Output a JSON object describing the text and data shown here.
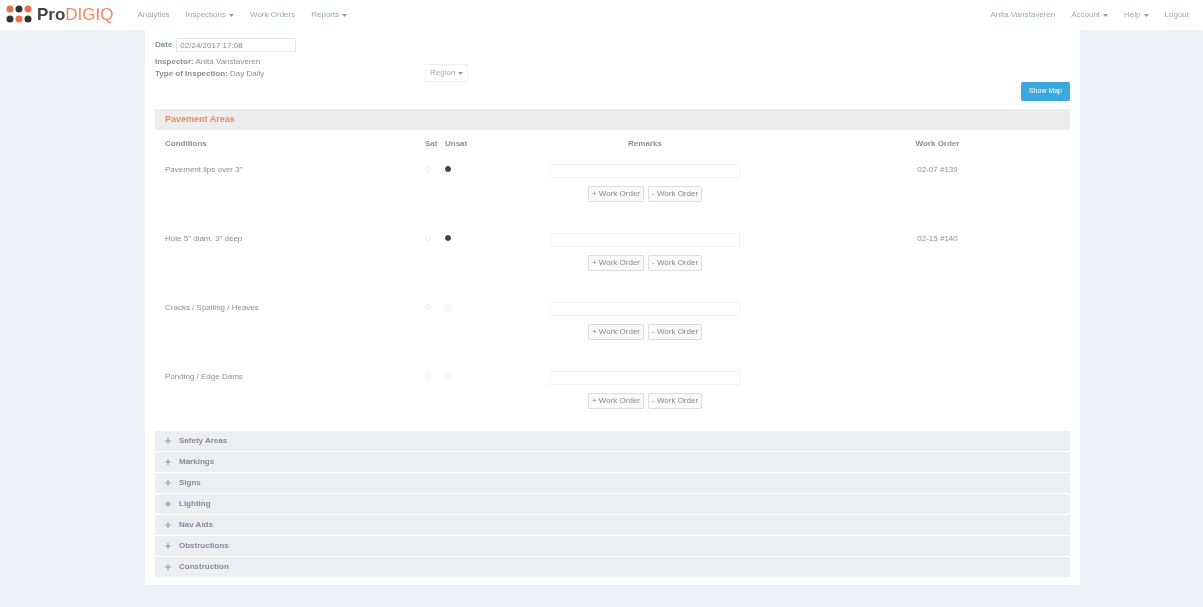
{
  "brand": {
    "prefix": "Pro",
    "suffix": "DIGIQ"
  },
  "nav_left": [
    {
      "label": "Analytics",
      "dropdown": false
    },
    {
      "label": "Inspections",
      "dropdown": true
    },
    {
      "label": "Work Orders",
      "dropdown": false
    },
    {
      "label": "Reports",
      "dropdown": true
    }
  ],
  "nav_right": [
    {
      "label": "Anita Vanstaveren",
      "dropdown": false
    },
    {
      "label": "Account",
      "dropdown": true
    },
    {
      "label": "Help",
      "dropdown": true
    },
    {
      "label": "Logout",
      "dropdown": false
    }
  ],
  "date": {
    "label": "Date",
    "value": "02/24/2017 17:08"
  },
  "inspector": {
    "label": "Inspector:",
    "value": "Anita Vanstaveren"
  },
  "inspection_type": {
    "label": "Type of Inspection:",
    "value": "Day Daily"
  },
  "region_select": {
    "value": "Region"
  },
  "show_map_button": "Show Map",
  "open_section": {
    "title": "Pavement Areas",
    "columns": [
      "Conditions",
      "Sat",
      "Unsat",
      "Remarks",
      "Work Order"
    ],
    "rows": [
      {
        "condition": "Pavement lips over 3\"",
        "sat": false,
        "unsat": true,
        "work_order": "02-07 #139",
        "add_label": "+ Work Order",
        "remove_label": "- Work Order"
      },
      {
        "condition": "Hole 5\" diam. 3\" deep",
        "sat": false,
        "unsat": true,
        "work_order": "02-15 #140",
        "add_label": "+ Work Order",
        "remove_label": "- Work Order"
      },
      {
        "condition": "Cracks / Spalling / Heaves",
        "sat": false,
        "unsat": false,
        "add_label": "+ Work Order",
        "remove_label": "- Work Order"
      },
      {
        "condition": "Ponding / Edge Dams",
        "sat": false,
        "unsat": false,
        "add_label": "+ Work Order",
        "remove_label": "- Work Order"
      }
    ]
  },
  "sections": [
    {
      "title": "Safety Areas",
      "expanded": false
    },
    {
      "title": "Markings",
      "expanded": false
    },
    {
      "title": "Signs",
      "expanded": false
    },
    {
      "title": "Lighting",
      "expanded": false
    },
    {
      "title": "Nav Aids",
      "expanded": false
    },
    {
      "title": "Obstructions",
      "expanded": false
    },
    {
      "title": "Construction",
      "expanded": false
    }
  ]
}
